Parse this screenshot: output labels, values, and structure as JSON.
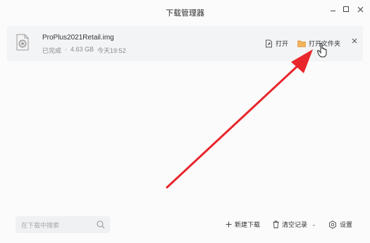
{
  "window": {
    "title": "下载管理器"
  },
  "download_item": {
    "file_name": "ProPlus2021Retail.img",
    "status": "已完成",
    "separator": "-",
    "size": "4.63 GB",
    "time": "今天19:52",
    "icon": "disc-image-file-icon",
    "actions": {
      "open_label": "打开",
      "open_folder_label": "打开文件夹"
    }
  },
  "bottom_bar": {
    "search_placeholder": "在下载中搜索",
    "new_download_label": "新建下载",
    "clear_records_label": "清空记录",
    "settings_label": "设置"
  },
  "colors": {
    "annotation_arrow": "#e8262c",
    "folder_icon": "#f2b35a"
  }
}
